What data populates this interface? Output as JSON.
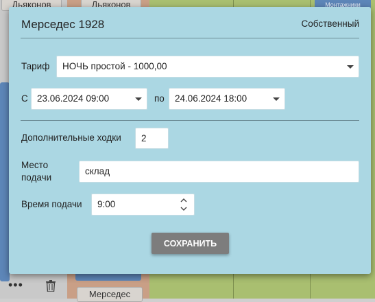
{
  "background": {
    "chip_top_1": "Дьяконов",
    "chip_top_2": "Дьяконов",
    "chip_top_right": "Монтажники",
    "chip_bottom": "Мерседес"
  },
  "dialog": {
    "title": "Мерседес 1928",
    "ownership": "Собственный",
    "tariff": {
      "label": "Тариф",
      "value": "НОЧЬ простой - 1000,00"
    },
    "from": {
      "label": "С",
      "value": "23.06.2024 09:00"
    },
    "to": {
      "label": "по",
      "value": "24.06.2024 18:00"
    },
    "extra_trips": {
      "label": "Дополнительные ходки",
      "value": "2"
    },
    "place": {
      "label_line1": "Место",
      "label_line2": "подачи",
      "value": "склад"
    },
    "time": {
      "label": "Время подачи",
      "value": "9:00"
    },
    "save_label": "СОХРАНИТЬ"
  }
}
